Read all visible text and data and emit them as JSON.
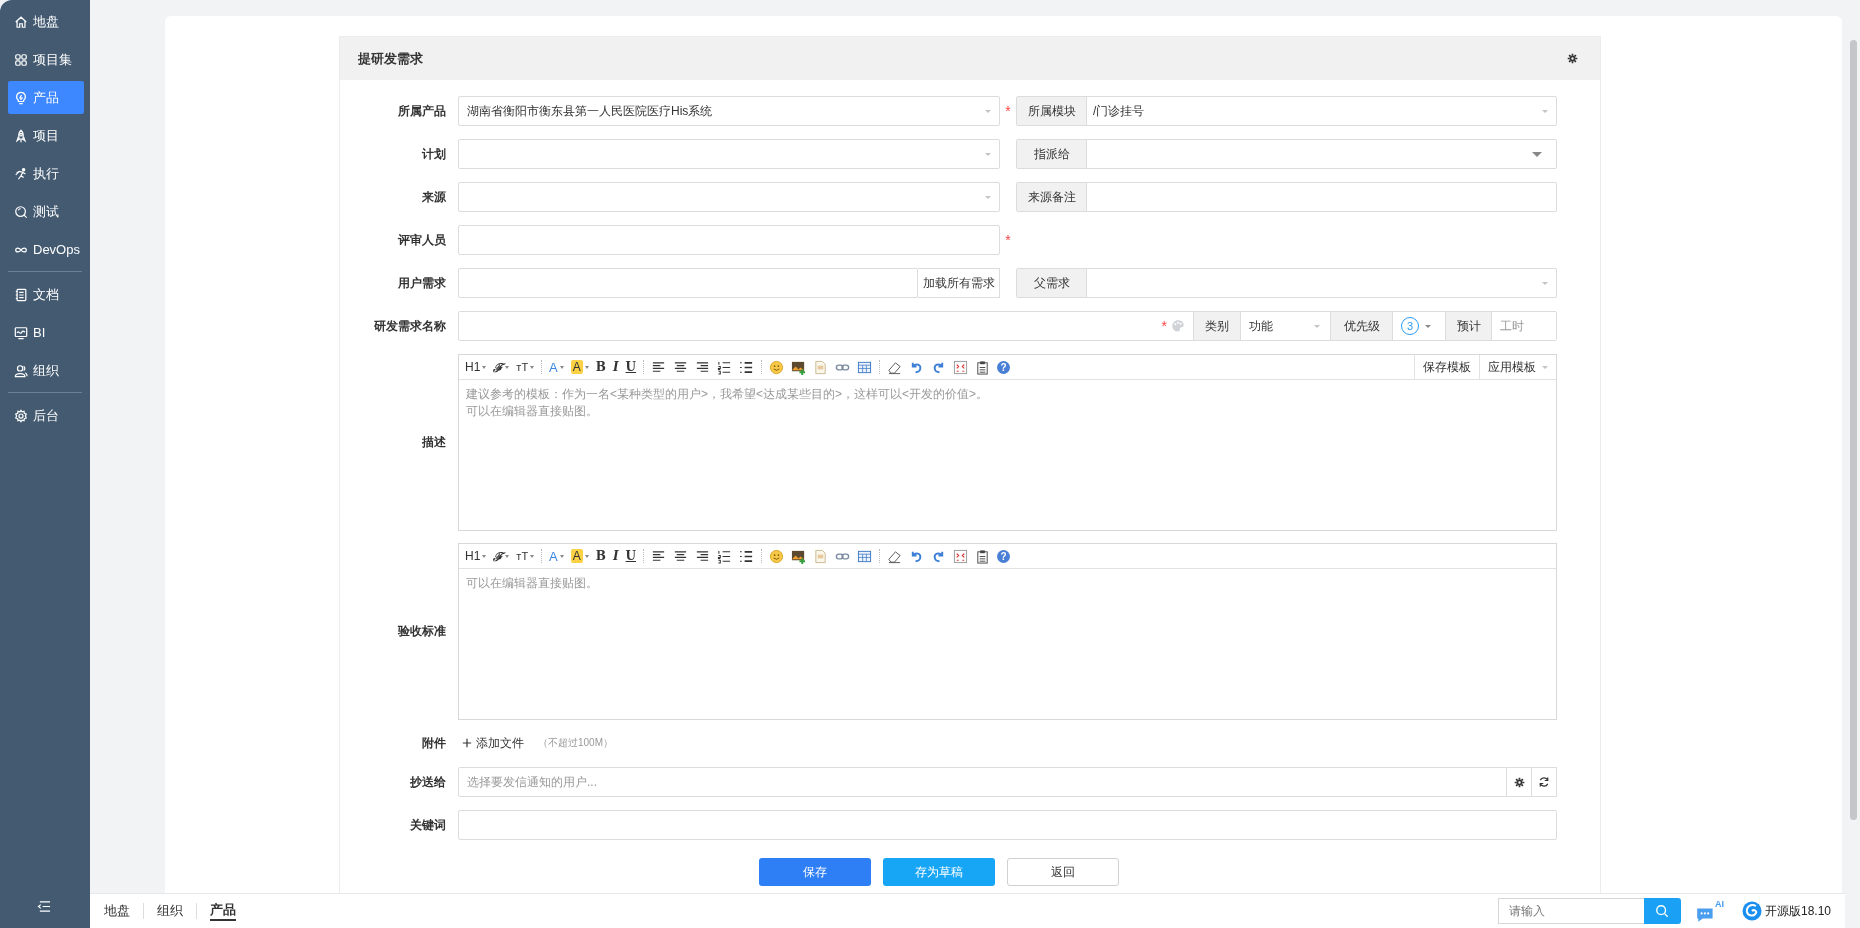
{
  "sidebar": {
    "groups": [
      [
        {
          "kind": "home",
          "label": "地盘",
          "selected": false
        },
        {
          "kind": "grid",
          "label": "项目集",
          "selected": false
        },
        {
          "kind": "bulb",
          "label": "产品",
          "selected": true
        },
        {
          "kind": "rocket",
          "label": "项目",
          "selected": false
        },
        {
          "kind": "run",
          "label": "执行",
          "selected": false
        },
        {
          "kind": "test",
          "label": "测试",
          "selected": false
        },
        {
          "kind": "loop",
          "label": "DevOps",
          "selected": false
        }
      ],
      [
        {
          "kind": "doc",
          "label": "文档",
          "selected": false
        },
        {
          "kind": "chart",
          "label": "BI",
          "selected": false
        },
        {
          "kind": "user",
          "label": "组织",
          "selected": false
        }
      ],
      [
        {
          "kind": "gear",
          "label": "后台",
          "selected": false
        }
      ]
    ]
  },
  "form": {
    "title": "提研发需求",
    "product": {
      "label": "所属产品",
      "value": "湖南省衡阳市衡东县第一人民医院医疗His系统",
      "required_mark": "*"
    },
    "module": {
      "label": "所属模块",
      "value": "/门诊挂号"
    },
    "plan": {
      "label": "计划"
    },
    "assignee": {
      "label": "指派给"
    },
    "source": {
      "label": "来源"
    },
    "source_note": {
      "label": "来源备注"
    },
    "reviewer": {
      "label": "评审人员",
      "required_mark": "*"
    },
    "user_story": {
      "label": "用户需求",
      "button": "加载所有需求"
    },
    "parent": {
      "label": "父需求"
    },
    "name": {
      "label": "研发需求名称",
      "required_mark": "*"
    },
    "category": {
      "label": "类别",
      "value": "功能"
    },
    "priority": {
      "label": "优先级",
      "value": "3"
    },
    "estimate": {
      "label": "预计",
      "placeholder": "工时"
    },
    "description": {
      "label": "描述",
      "toolbar": [
        {
          "kind": "heading",
          "label": "H1"
        },
        {
          "kind": "font",
          "label": "ℱ"
        },
        {
          "kind": "size",
          "label": "ᴛT"
        },
        {
          "kind": "sep"
        },
        {
          "kind": "color",
          "label": "A"
        },
        {
          "kind": "bgcolor",
          "label": "A"
        },
        {
          "kind": "bold",
          "label": "B"
        },
        {
          "kind": "italic",
          "label": "I"
        },
        {
          "kind": "underline",
          "label": "U"
        },
        {
          "kind": "sep"
        },
        {
          "kind": "align-left"
        },
        {
          "kind": "align-center"
        },
        {
          "kind": "align-right"
        },
        {
          "kind": "ol"
        },
        {
          "kind": "ul"
        },
        {
          "kind": "sep"
        },
        {
          "kind": "emoji"
        },
        {
          "kind": "image"
        },
        {
          "kind": "code"
        },
        {
          "kind": "link"
        },
        {
          "kind": "table"
        },
        {
          "kind": "sep"
        },
        {
          "kind": "eraser"
        },
        {
          "kind": "undo"
        },
        {
          "kind": "redo"
        },
        {
          "kind": "fullscreen"
        },
        {
          "kind": "paste"
        },
        {
          "kind": "help",
          "label": "?"
        }
      ],
      "template_buttons": [
        {
          "label": "保存模板",
          "caret": false
        },
        {
          "label": "应用模板",
          "caret": true
        }
      ],
      "placeholder_lines": [
        "建议参考的模板：作为一名<某种类型的用户>，我希望<达成某些目的>，这样可以<开发的价值>。",
        "可以在编辑器直接贴图。"
      ]
    },
    "acceptance": {
      "label": "验收标准",
      "toolbar": [
        {
          "kind": "heading",
          "label": "H1"
        },
        {
          "kind": "font",
          "label": "ℱ"
        },
        {
          "kind": "size",
          "label": "ᴛT"
        },
        {
          "kind": "sep"
        },
        {
          "kind": "color",
          "label": "A"
        },
        {
          "kind": "bgcolor",
          "label": "A"
        },
        {
          "kind": "bold",
          "label": "B"
        },
        {
          "kind": "italic",
          "label": "I"
        },
        {
          "kind": "underline",
          "label": "U"
        },
        {
          "kind": "sep"
        },
        {
          "kind": "align-left"
        },
        {
          "kind": "align-center"
        },
        {
          "kind": "align-right"
        },
        {
          "kind": "ol"
        },
        {
          "kind": "ul"
        },
        {
          "kind": "sep"
        },
        {
          "kind": "emoji"
        },
        {
          "kind": "image"
        },
        {
          "kind": "code"
        },
        {
          "kind": "link"
        },
        {
          "kind": "table"
        },
        {
          "kind": "sep"
        },
        {
          "kind": "eraser"
        },
        {
          "kind": "undo"
        },
        {
          "kind": "redo"
        },
        {
          "kind": "fullscreen"
        },
        {
          "kind": "paste"
        },
        {
          "kind": "help",
          "label": "?"
        }
      ],
      "placeholder_lines": [
        "可以在编辑器直接贴图。"
      ]
    },
    "attachment": {
      "label": "附件",
      "button": "添加文件",
      "note": "（不超过100M）"
    },
    "mailto": {
      "label": "抄送给",
      "placeholder": "选择要发信通知的用户..."
    },
    "keywords": {
      "label": "关键词"
    },
    "actions": [
      {
        "kind": "primary",
        "label": "保存"
      },
      {
        "kind": "draft",
        "label": "存为草稿"
      },
      {
        "kind": "plain",
        "label": "返回"
      }
    ]
  },
  "bottom_bar": {
    "breadcrumbs": [
      {
        "label": "地盘",
        "selected": false
      },
      {
        "label": "组织",
        "selected": false
      },
      {
        "label": "产品",
        "selected": true
      }
    ],
    "search": {
      "placeholder": "请输入"
    },
    "ai_badge": "AI",
    "version": "开源版18.10"
  }
}
